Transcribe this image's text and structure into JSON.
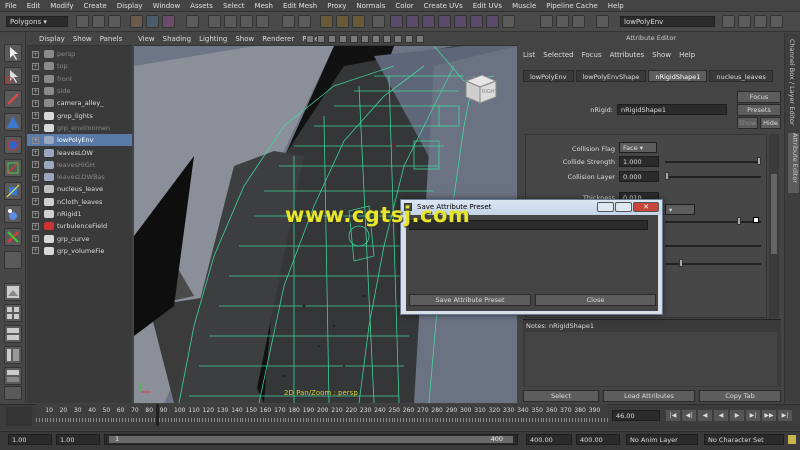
{
  "menubar": [
    "File",
    "Edit",
    "Modify",
    "Create",
    "Display",
    "Window",
    "Assets",
    "Select",
    "Mesh",
    "Edit Mesh",
    "Proxy",
    "Normals",
    "Color",
    "Create UVs",
    "Edit UVs",
    "Muscle",
    "Pipeline Cache",
    "Help"
  ],
  "status": {
    "mode": "Polygons",
    "help_field": "lowPolyEnv"
  },
  "outliner": {
    "menu": [
      "Display",
      "Show",
      "Panels"
    ],
    "items": [
      {
        "label": "persp",
        "state": "dim",
        "icon": "camera-icon"
      },
      {
        "label": "top",
        "state": "dim",
        "icon": "camera-icon"
      },
      {
        "label": "front",
        "state": "dim",
        "icon": "camera-icon"
      },
      {
        "label": "side",
        "state": "dim",
        "icon": "camera-icon"
      },
      {
        "label": "camera_alley_",
        "state": "normal",
        "icon": "camera-icon"
      },
      {
        "label": "grop_lights",
        "state": "normal",
        "icon": "group-icon"
      },
      {
        "label": "grp_environmen",
        "state": "dim",
        "icon": "group-icon"
      },
      {
        "label": "lowPolyEnv",
        "state": "selected",
        "icon": "mesh-icon"
      },
      {
        "label": "leavesLOW",
        "state": "normal",
        "icon": "mesh-icon"
      },
      {
        "label": "leavesHIGH",
        "state": "dim",
        "icon": "mesh-icon"
      },
      {
        "label": "leavesLOWBas",
        "state": "dim",
        "icon": "mesh-icon"
      },
      {
        "label": "nucleus_leave",
        "state": "normal",
        "icon": "nucleus-icon"
      },
      {
        "label": "nCloth_leaves",
        "state": "normal",
        "icon": "ncloth-icon"
      },
      {
        "label": "nRigid1",
        "state": "normal",
        "icon": "nrigid-icon"
      },
      {
        "label": "turbulenceField",
        "state": "normal",
        "icon": "field-icon"
      },
      {
        "label": "grp_curve",
        "state": "normal",
        "icon": "group-icon"
      },
      {
        "label": "grp_volumeFie",
        "state": "normal",
        "icon": "group-icon"
      }
    ]
  },
  "viewport": {
    "menu": [
      "View",
      "Shading",
      "Lighting",
      "Show",
      "Renderer",
      "Panels"
    ],
    "camera_label": "2D Pan/Zoom : persp",
    "viewcube_label": "RIGHT"
  },
  "attribute_editor": {
    "title": "Attribute Editor",
    "menu": [
      "List",
      "Selected",
      "Focus",
      "Attributes",
      "Show",
      "Help"
    ],
    "tabs": [
      "lowPolyEnv",
      "lowPolyEnvShape",
      "nRigidShape1",
      "nucleus_leaves"
    ],
    "active_tab": 2,
    "node_label": "nRigid:",
    "node_value": "nRigidShape1",
    "focus": "Focus",
    "presets": "Presets",
    "show": "Show",
    "hide": "Hide",
    "collision_flag_label": "Collision Flag",
    "collision_flag_value": "Face",
    "collide_strength_label": "Collide Strength",
    "collide_strength_value": "1.000",
    "collision_layer_label": "Collision Layer",
    "collision_layer_value": "0.000",
    "thickness_label": "Thickness",
    "thickness_value": "0.010",
    "notes": "Notes:  nRigidShape1",
    "select": "Select",
    "load_attributes": "Load Attributes",
    "copy_tab": "Copy Tab"
  },
  "side_tabs": [
    "Channel Box / Layer Editor",
    "Attribute Editor"
  ],
  "dialog": {
    "title": "Save Attribute Preset",
    "save_button": "Save Attribute Preset",
    "close_button": "Close"
  },
  "watermark": "www.cgtsj.com",
  "timeline": {
    "ticks": [
      "10",
      "20",
      "30",
      "40",
      "50",
      "60",
      "70",
      "80",
      "90",
      "100",
      "110",
      "120",
      "130",
      "140",
      "150",
      "160",
      "170",
      "180",
      "190",
      "200",
      "210",
      "220",
      "230",
      "240",
      "250",
      "260",
      "270",
      "280",
      "290",
      "300",
      "310",
      "320",
      "330",
      "340",
      "350",
      "360",
      "370",
      "380",
      "390"
    ],
    "current_frame": "46.00",
    "start_field": "1.00",
    "start_range": "1.00",
    "range_start": "1",
    "range_end": "400",
    "end_range": "400.00",
    "end_field": "400.00",
    "anim_layer": "No Anim Layer",
    "character_set": "No Character Set"
  }
}
